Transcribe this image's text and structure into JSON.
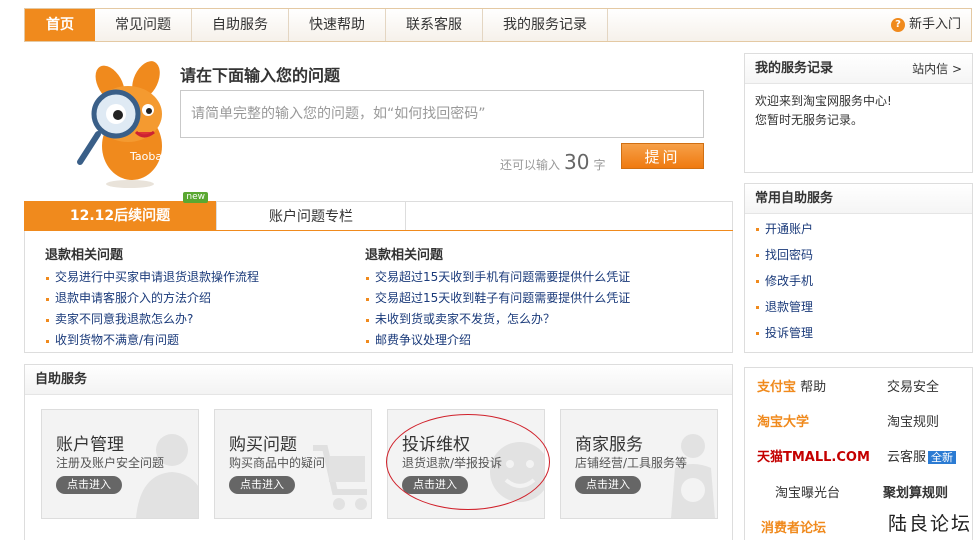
{
  "nav": {
    "tabs": [
      "首页",
      "常见问题",
      "自助服务",
      "快速帮助",
      "联系客服",
      "我的服务记录"
    ],
    "help_label": "新手入门"
  },
  "ask": {
    "title": "请在下面输入您的问题",
    "placeholder": "请简单完整的输入您的问题，如“如何找回密码”",
    "remain_prefix": "还可以输入",
    "remain_count": "30",
    "remain_suffix": "字",
    "button": "提问"
  },
  "issues": {
    "tabs": [
      "12.12后续问题",
      "账户问题专栏"
    ],
    "new_badge": "new",
    "columns": [
      {
        "title": "退款相关问题",
        "items": [
          "交易进行中买家申请退货退款操作流程",
          "退款申请客服介入的方法介绍",
          "卖家不同意我退款怎么办?",
          "收到货物不满意/有问题"
        ]
      },
      {
        "title": "退款相关问题",
        "items": [
          "交易超过15天收到手机有问题需要提供什么凭证",
          "交易超过15天收到鞋子有问题需要提供什么凭证",
          "未收到货或卖家不发货，怎么办？",
          "邮费争议处理介绍"
        ]
      }
    ]
  },
  "self_service": {
    "title": "自助服务",
    "cards": [
      {
        "title": "账户管理",
        "sub": "注册及账户安全问题",
        "enter": "点击进入"
      },
      {
        "title": "购买问题",
        "sub": "购买商品中的疑问",
        "enter": "点击进入"
      },
      {
        "title": "投诉维权",
        "sub": "退货退款/举报投诉",
        "enter": "点击进入"
      },
      {
        "title": "商家服务",
        "sub": "店铺经营/工具服务等",
        "enter": "点击进入"
      }
    ]
  },
  "service_record": {
    "title": "我的服务记录",
    "link": "站内信 >",
    "line1": "欢迎来到淘宝网服务中心!",
    "line2": "您暂时无服务记录。"
  },
  "common_self": {
    "title": "常用自助服务",
    "items": [
      "开通账户",
      "找回密码",
      "修改手机",
      "退款管理",
      "投诉管理"
    ]
  },
  "links": {
    "alipay_brand": "支付宝",
    "alipay_help": "帮助",
    "trade_safety": "交易安全",
    "taobao_univ": "淘宝大学",
    "taobao_rules": "淘宝规则",
    "tmall": "天猫TMALL.COM",
    "cloud_service": "云客服",
    "cloud_new": "全新",
    "exposure": "淘宝曝光台",
    "juhuasuan": "聚划算规则",
    "consumer_forum": "消费者论坛"
  },
  "mascot_text": "Taobao",
  "watermark": "陆良论坛",
  "colors": {
    "accent": "#f08a1d",
    "link": "#1a3a7a",
    "annotation": "#d0202a"
  }
}
